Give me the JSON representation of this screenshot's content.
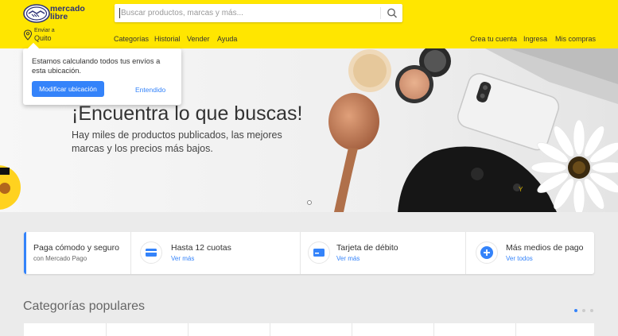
{
  "header": {
    "logo_line1": "mercado",
    "logo_line2": "libre",
    "search_placeholder": "Buscar productos, marcas y más...",
    "location_label": "Enviar a",
    "location_value": "Quito",
    "nav": [
      "Categorías",
      "Historial",
      "Vender",
      "Ayuda"
    ],
    "account": [
      "Crea tu cuenta",
      "Ingresa",
      "Mis compras"
    ]
  },
  "popup": {
    "text": "Estamos calculando todos tus envíos a esta ubicación.",
    "button": "Modificar ubicación",
    "link": "Entendido"
  },
  "hero": {
    "title": "¡Encuentra lo que buscas!",
    "subtitle": "Hay miles de productos publicados, las mejores marcas y los precios más bajos."
  },
  "payment": {
    "first_title": "Paga cómodo y seguro",
    "first_sub": "con Mercado Pago",
    "items": [
      {
        "title": "Hasta 12 cuotas",
        "link": "Ver más",
        "icon": "card-icon"
      },
      {
        "title": "Tarjeta de débito",
        "link": "Ver más",
        "icon": "debit-card-icon"
      },
      {
        "title": "Más medios de pago",
        "link": "Ver todos",
        "icon": "plus-icon"
      }
    ]
  },
  "categories": {
    "title": "Categorías populares"
  },
  "colors": {
    "brand_yellow": "#ffe600",
    "accent_blue": "#3483fa"
  }
}
